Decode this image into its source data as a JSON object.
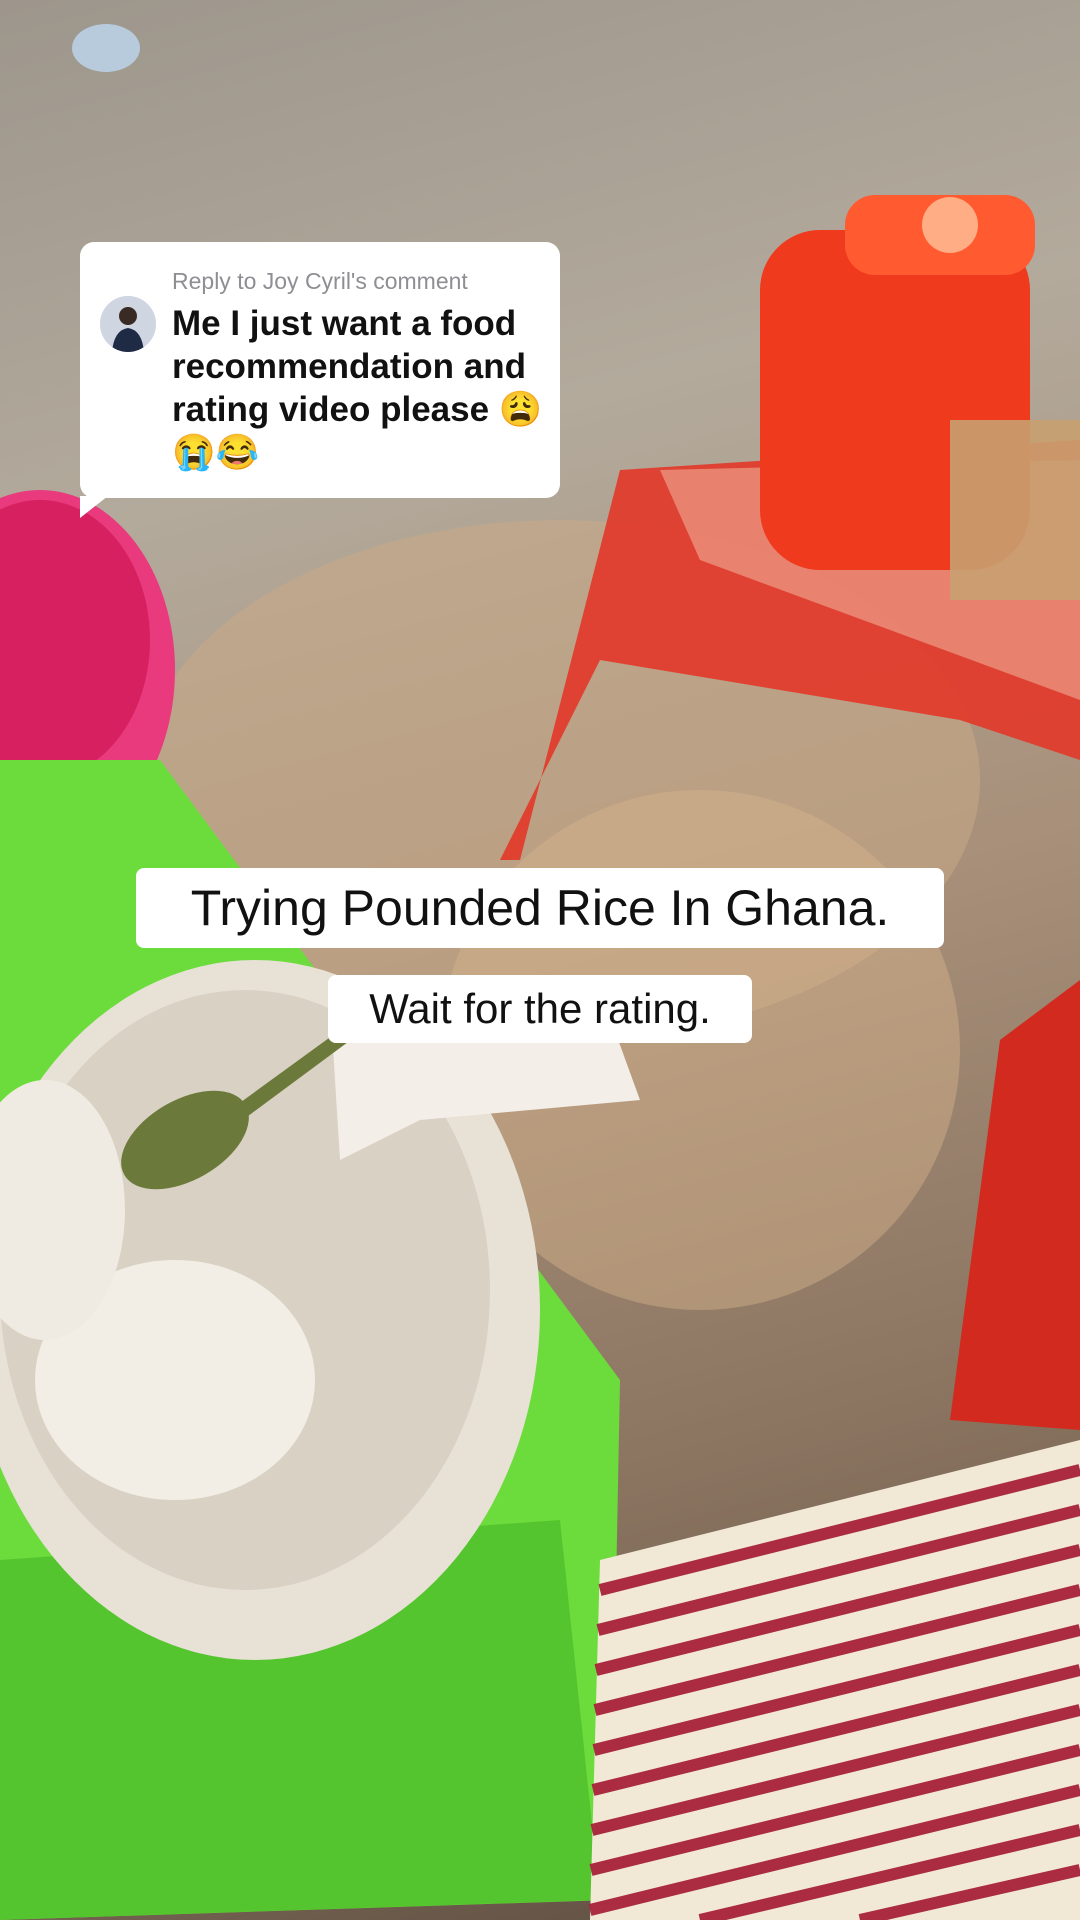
{
  "reply_comment": {
    "header": "Reply to Joy Cyril's comment",
    "text": "Me I just want a food recommendation and rating video please 😩😭😂",
    "avatar_icon": "user-avatar-icon"
  },
  "captions": {
    "title": "Trying Pounded Rice In Ghana.",
    "subtitle": "Wait for the rating."
  },
  "colors": {
    "card_background": "#ffffff",
    "card_header_text": "#8e8e93",
    "card_body_text": "#111111"
  }
}
